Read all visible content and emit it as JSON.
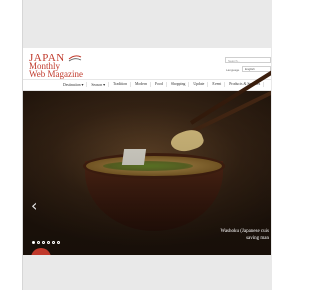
{
  "logo": {
    "line1": "JAPAN",
    "line2": "Monthly",
    "line3": "Web Magazine"
  },
  "search": {
    "placeholder": "Search..."
  },
  "language": {
    "label": "Language",
    "selected": "English"
  },
  "nav": {
    "items": [
      "Destination ▾",
      "Season ▾",
      "Tradition",
      "Modern",
      "Food",
      "Shopping",
      "Update",
      "Event",
      "Products & Services"
    ]
  },
  "hero": {
    "caption_line1": "Washoku (Japanese cuis",
    "caption_line2": "saving man",
    "slides": 6,
    "active_slide": 1
  },
  "colors": {
    "brand": "#c0392b",
    "background": "#e9e9e9"
  },
  "icons": {
    "prev": "chevron-left-icon",
    "logo_mark": "fuji-wave-icon"
  }
}
